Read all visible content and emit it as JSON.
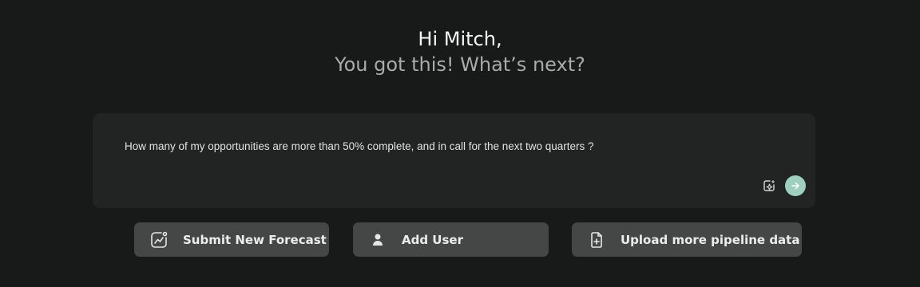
{
  "greeting": {
    "name_line": "Hi Mitch,",
    "sub_line": "You got this! What’s next?"
  },
  "prompt": {
    "text": "How many of my opportunities are more than 50% complete, and in call for the next two quarters ?",
    "sparkle_icon": "ai-sparkle-icon",
    "send_icon": "arrow-right-icon"
  },
  "actions": [
    {
      "label": "Submit New Forecast",
      "icon": "chart-trend-icon"
    },
    {
      "label": "Add User",
      "icon": "user-icon"
    },
    {
      "label": "Upload more pipeline data",
      "icon": "file-plus-icon"
    }
  ],
  "colors": {
    "background": "#181919",
    "prompt_box": "#222323",
    "action_button": "#454646",
    "send_button": "#9fcfbf",
    "subtitle": "#a9aaaa"
  }
}
